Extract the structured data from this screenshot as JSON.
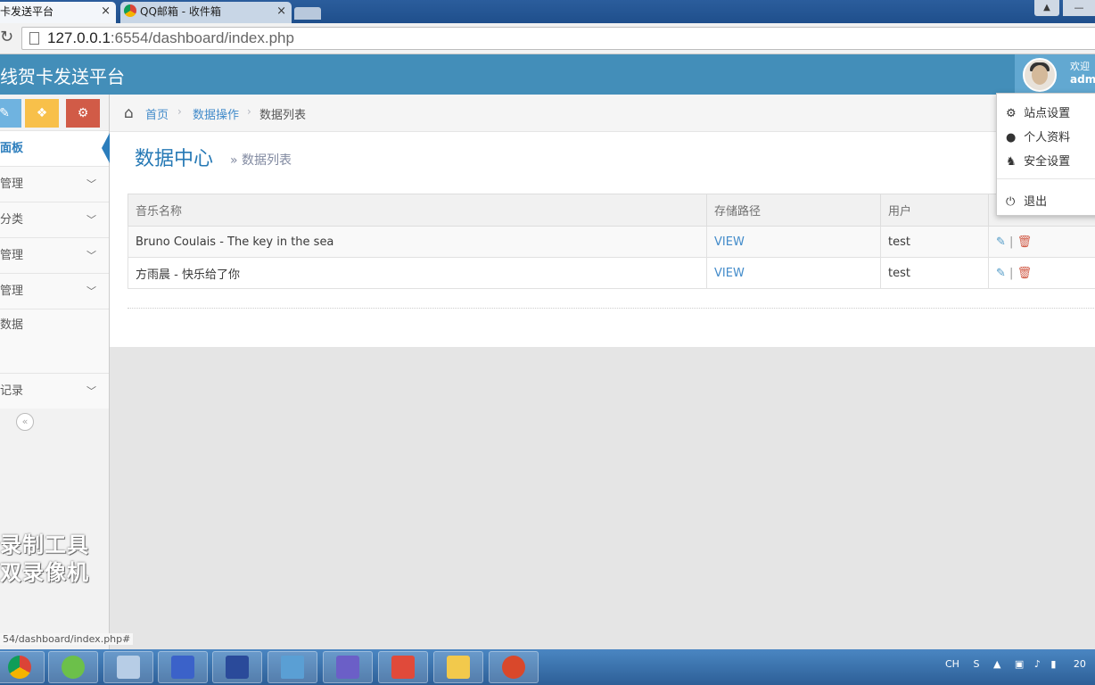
{
  "browser": {
    "tabs": [
      {
        "label": "卡发送平台",
        "close": "×"
      },
      {
        "label": "QQ邮箱 - 收件箱",
        "close": "×"
      }
    ],
    "url_host": "127.0.0.1",
    "url_rest": ":6554/dashboard/index.php"
  },
  "header": {
    "brand": "线贺卡发送平台",
    "welcome_line1": "欢迎",
    "welcome_line2": "adm"
  },
  "sidebar": {
    "items": [
      {
        "label": "面板"
      },
      {
        "label": "管理"
      },
      {
        "label": "分类"
      },
      {
        "label": "管理"
      },
      {
        "label": "管理"
      },
      {
        "label": "数据"
      },
      {
        "label": "记录"
      }
    ],
    "collapse_icon": "«",
    "watermark_line1": "录制工具",
    "watermark_line2": "双录像机",
    "status_url": "54/dashboard/index.php#"
  },
  "breadcrumb": {
    "home": "首页",
    "section": "数据操作",
    "current": "数据列表"
  },
  "page": {
    "title": "数据中心",
    "subtitle": "» 数据列表"
  },
  "table": {
    "headers": [
      "音乐名称",
      "存储路径",
      "用户",
      ""
    ],
    "rows": [
      {
        "name": "Bruno Coulais - The key in the sea",
        "path": "VIEW",
        "user": "test"
      },
      {
        "name": "方雨晨 - 快乐给了你",
        "path": "VIEW",
        "user": "test"
      }
    ]
  },
  "dropdown": {
    "items": [
      {
        "label": "站点设置",
        "icon": "gear-icon"
      },
      {
        "label": "个人资料",
        "icon": "user-icon"
      },
      {
        "label": "安全设置",
        "icon": "user-secret-icon"
      },
      {
        "label": "退出",
        "icon": "power-icon"
      }
    ]
  },
  "taskbar": {
    "tray_text": "CH",
    "clock": "20"
  },
  "colors": {
    "navbar": "#438eb9",
    "accent": "#2679b5",
    "sidebar_btn_blue": "#6fb3e0",
    "sidebar_btn_yellow": "#f8c04a",
    "sidebar_btn_red": "#d15b47"
  }
}
